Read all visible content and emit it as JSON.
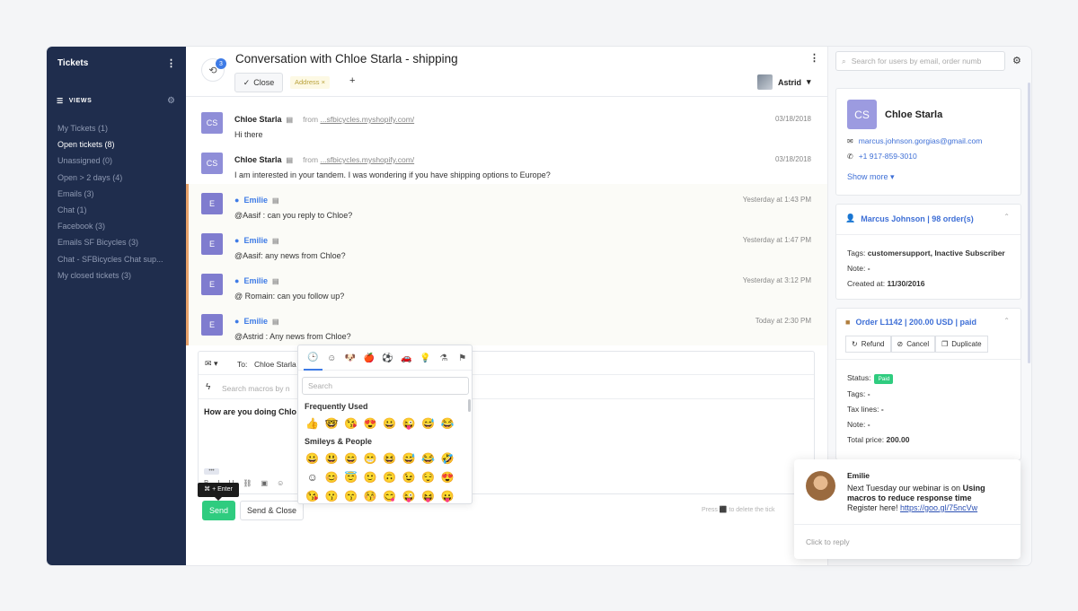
{
  "sidebar": {
    "title": "Tickets",
    "views_label": "VIEWS",
    "items": [
      {
        "label": "My Tickets (1)"
      },
      {
        "label": "Open tickets (8)"
      },
      {
        "label": "Unassigned (0)"
      },
      {
        "label": "Open > 2 days (4)"
      },
      {
        "label": "Emails (3)"
      },
      {
        "label": "Chat (1)"
      },
      {
        "label": "Facebook (3)"
      },
      {
        "label": "Emails SF Bicycles (3)"
      },
      {
        "label": "Chat - SFBicycles Chat sup..."
      },
      {
        "label": "My closed tickets (3)"
      }
    ],
    "active_index": 1
  },
  "header": {
    "history_count": "3",
    "title": "Conversation with Chloe Starla - shipping",
    "close_label": "Close",
    "tag": "Address",
    "tag_remove": "×",
    "add_tag": "+",
    "agent": "Astrid"
  },
  "messages": [
    {
      "initials": "CS",
      "author": "Chloe Starla",
      "from_label": "from",
      "from_source": "...sfbicycles.myshopify.com/",
      "time": "03/18/2018",
      "body": "Hi there"
    },
    {
      "initials": "CS",
      "author": "Chloe Starla",
      "from_label": "from",
      "from_source": "...sfbicycles.myshopify.com/",
      "time": "03/18/2018",
      "body": "I am interested in your tandem. I was wondering if you have shipping options to Europe?"
    },
    {
      "initials": "E",
      "author": "Emilie",
      "time": "Yesterday at 1:43 PM",
      "body": "@Aasif : can you reply to Chloe?"
    },
    {
      "initials": "E",
      "author": "Emilie",
      "time": "Yesterday at 1:47 PM",
      "body": "@Aasif: any news from Chloe?"
    },
    {
      "initials": "E",
      "author": "Emilie",
      "time": "Yesterday at 3:12 PM",
      "body": "@ Romain: can you follow up?"
    },
    {
      "initials": "E",
      "author": "Emilie",
      "time": "Today at 2:30 PM",
      "body": "@Astrid : Any news from Chloe?"
    }
  ],
  "composer": {
    "to_label": "To:",
    "to_value": "Chloe Starla",
    "macro_placeholder": "Search macros by n",
    "text": "How are you doing Chlo",
    "more": "•••",
    "format_tools": [
      "B",
      "I",
      "U",
      "⛓",
      "▣",
      "☺"
    ],
    "tooltip": "⌘ + Enter",
    "send_label": "Send",
    "send_close_label": "Send & Close",
    "hint": "Press ⬛ to delete the tick"
  },
  "emoji_picker": {
    "tabs": [
      "🕒",
      "☺",
      "🐶",
      "🍎",
      "⚽",
      "🚗",
      "💡",
      "⚗",
      "⚑"
    ],
    "search_placeholder": "Search",
    "frequently_used_label": "Frequently Used",
    "frequently_used": [
      "👍",
      "🤓",
      "😘",
      "😍",
      "😀",
      "😜",
      "😅",
      "😂"
    ],
    "smileys_label": "Smileys & People",
    "smileys": [
      "😀",
      "😃",
      "😄",
      "😁",
      "😆",
      "😅",
      "😂",
      "🤣",
      "☺",
      "😊",
      "😇",
      "🙂",
      "🙃",
      "😉",
      "😌",
      "😍",
      "😘",
      "😗",
      "😙",
      "😚",
      "😋",
      "😜",
      "😝",
      "😛"
    ]
  },
  "right_panel": {
    "search_placeholder": "Search for users by email, order numb",
    "customer": {
      "initials": "CS",
      "name": "Chloe Starla",
      "email": "marcus.johnson.gorgias@gmail.com",
      "phone": "+1 917-859-3010",
      "show_more": "Show more"
    },
    "profile": {
      "title": "Marcus Johnson | 98 order(s)",
      "tags_label": "Tags:",
      "tags_value": "customersupport, Inactive Subscriber",
      "note_label": "Note:",
      "note_value": "-",
      "created_label": "Created at:",
      "created_value": "11/30/2016"
    },
    "order": {
      "title": "Order L1142 | 200.00 USD | paid",
      "refund": "Refund",
      "cancel": "Cancel",
      "duplicate": "Duplicate",
      "status_label": "Status:",
      "status_value": "Paid",
      "tags_label": "Tags:",
      "tags_value": "-",
      "tax_label": "Tax lines:",
      "tax_value": "-",
      "note_label": "Note:",
      "note_value": "-",
      "total_label": "Total price:",
      "total_value": "200.00"
    }
  },
  "notification": {
    "name": "Emilie",
    "line1": "Next Tuesday our webinar is on ",
    "bold": "Using macros to reduce response time",
    "line2": "Register here! ",
    "link": "https://goo.gl/75ncVw",
    "reply": "Click to reply"
  }
}
